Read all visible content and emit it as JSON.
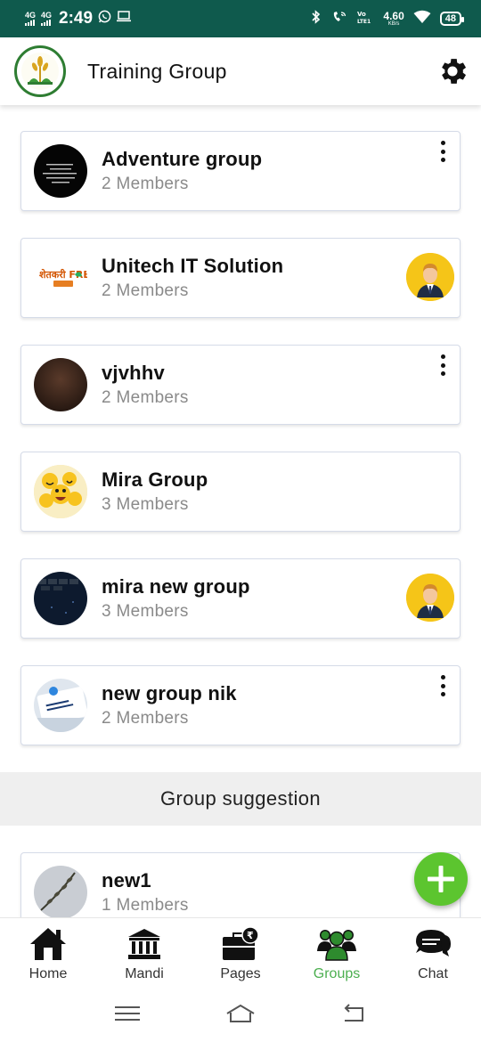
{
  "status_bar": {
    "net1": "4G",
    "net2": "4G",
    "time": "2:49",
    "speed_value": "4.60",
    "speed_unit": "KB/s",
    "volte": "VoLTE1",
    "battery": "48"
  },
  "app_bar": {
    "title": "Training Group",
    "logo_icon": "wheat-logo-icon",
    "settings_icon": "gear-icon"
  },
  "groups": [
    {
      "name": "Adventure group",
      "members": "2 Members",
      "action": "more"
    },
    {
      "name": "Unitech IT Solution",
      "members": "2 Members",
      "action": "admin",
      "avatar_text": "शेतकरी FRESH"
    },
    {
      "name": "vjvhhv",
      "members": "2 Members",
      "action": "more"
    },
    {
      "name": "Mira Group",
      "members": "3 Members",
      "action": "none"
    },
    {
      "name": "mira new group",
      "members": "3 Members",
      "action": "admin"
    },
    {
      "name": "new group nik",
      "members": "2 Members",
      "action": "more"
    }
  ],
  "suggestion": {
    "header": "Group suggestion",
    "items": [
      {
        "name": "new1",
        "members": "1 Members"
      }
    ]
  },
  "fab": {
    "icon": "plus-icon"
  },
  "bottom_nav": {
    "items": [
      {
        "label": "Home",
        "icon": "home-icon",
        "active": false
      },
      {
        "label": "Mandi",
        "icon": "bank-icon",
        "active": false
      },
      {
        "label": "Pages",
        "icon": "pages-icon",
        "active": false
      },
      {
        "label": "Groups",
        "icon": "groups-icon",
        "active": true
      },
      {
        "label": "Chat",
        "icon": "chat-icon",
        "active": false
      }
    ]
  },
  "colors": {
    "status_bar": "#0f5a4d",
    "accent_green": "#4caf50",
    "fab_green": "#5cc52f",
    "admin_badge": "#f5c518"
  }
}
